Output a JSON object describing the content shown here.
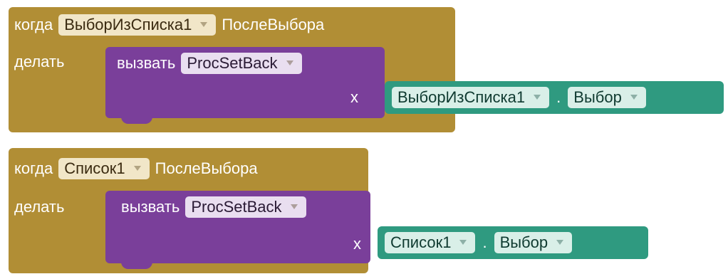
{
  "blocks": [
    {
      "when_kw": "когда",
      "component": "ВыборИзСписка1",
      "event": "ПослеВыбора",
      "do_kw": "делать",
      "call_kw": "вызвать",
      "procedure": "ProcSetBack",
      "arg_label": "x",
      "getter_component": "ВыборИзСписка1",
      "getter_dot": ".",
      "getter_property": "Выбор"
    },
    {
      "when_kw": "когда",
      "component": "Список1",
      "event": "ПослеВыбора",
      "do_kw": "делать",
      "call_kw": "вызвать",
      "procedure": "ProcSetBack",
      "arg_label": "x",
      "getter_component": "Список1",
      "getter_dot": ".",
      "getter_property": "Выбор"
    }
  ],
  "colors": {
    "event_block": "#b18e35",
    "procedure_call_block": "#7a3f9a",
    "getter_block": "#2f9a80",
    "background": "#ffffff"
  },
  "icons": {
    "dropdown": "chevron-down-icon"
  }
}
